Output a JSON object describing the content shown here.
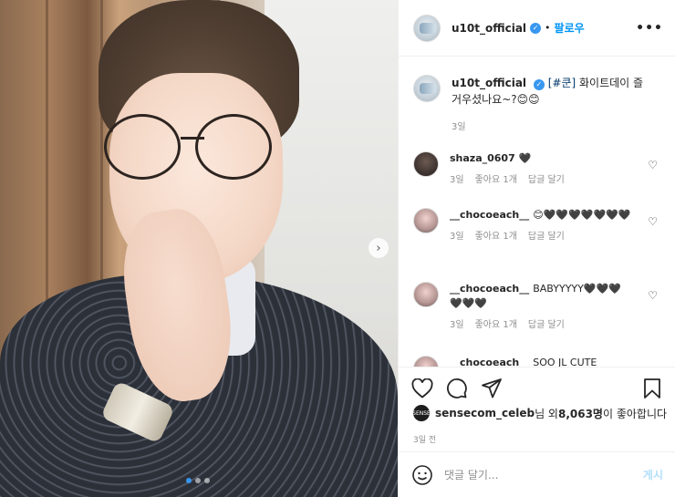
{
  "post": {
    "username": "u10t_official",
    "follow_label": "팔로우",
    "more_label": "•••",
    "caption_hashtag": "[#쿤]",
    "caption_text": " 화이트데이 즐거우셨나요~?😊😊",
    "caption_time": "3일"
  },
  "comments": [
    {
      "user": "shaza_0607",
      "text": "🖤",
      "time": "3일",
      "likes": "좋아요 1개",
      "reply": "답글 달기"
    },
    {
      "user": "__chocoeach__",
      "text": "😊🖤🖤🖤🖤🖤🖤🖤",
      "time": "3일",
      "likes": "좋아요 1개",
      "reply": "답글 달기"
    },
    {
      "user": "__chocoeach__",
      "text": "BABYYYYY🖤🖤🖤🖤🖤🖤",
      "time": "3일",
      "likes": "좋아요 1개",
      "reply": "답글 달기"
    },
    {
      "user": "__chocoeach__",
      "text": "SOO JL CUTE",
      "time": "",
      "likes": "",
      "reply": ""
    }
  ],
  "likes": {
    "avatar_label": "SENSE",
    "user": "sensecom_celeb",
    "middle": "님 외 ",
    "count": "8,063명",
    "suffix": "이 좋아합니다"
  },
  "posted": "3일 전",
  "add_comment": {
    "placeholder": "댓글 달기...",
    "post_label": "게시"
  },
  "icons": [
    "verified-icon",
    "more-icon",
    "heart-icon",
    "comment-icon",
    "share-icon",
    "bookmark-icon",
    "emoji-icon",
    "chevron-right-icon"
  ],
  "colors": {
    "link": "#0095f6",
    "hashtag": "#00376b",
    "muted": "#8e8e8e",
    "verified": "#3897f0",
    "post_disabled": "#b2dffc"
  },
  "carousel": {
    "total": 3,
    "current": 1
  }
}
